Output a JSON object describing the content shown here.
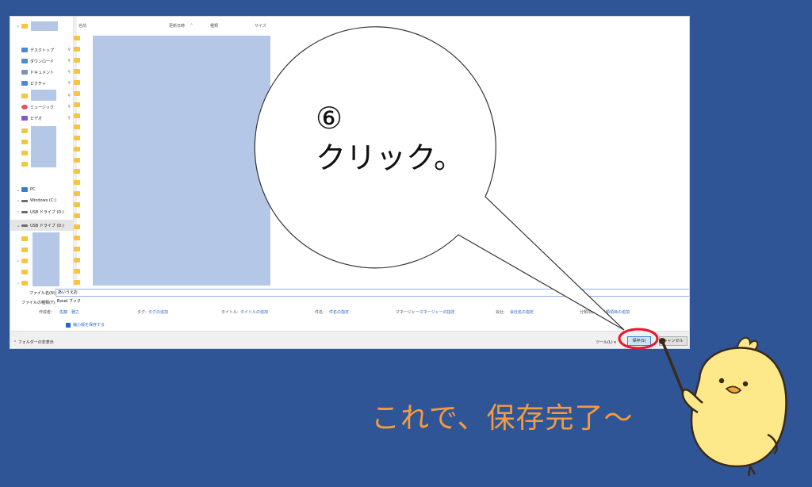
{
  "dialog": {
    "nav_items": [
      {
        "label": "",
        "icon": "folder-icon",
        "pinned": false
      },
      {
        "label": "デスクトップ",
        "icon": "desktop-icon",
        "pinned": true
      },
      {
        "label": "ダウンロード",
        "icon": "download-icon",
        "pinned": true
      },
      {
        "label": "ドキュメント",
        "icon": "document-icon",
        "pinned": true
      },
      {
        "label": "ピクチャ",
        "icon": "picture-icon",
        "pinned": true
      },
      {
        "label": "",
        "icon": "folder-icon",
        "pinned": true
      },
      {
        "label": "ミュージック",
        "icon": "music-icon",
        "pinned": true
      },
      {
        "label": "ビデオ",
        "icon": "video-icon",
        "pinned": true
      },
      {
        "label": "PC",
        "icon": "pc-icon",
        "pinned": false
      },
      {
        "label": "Windows (C:)",
        "icon": "drive-icon",
        "pinned": false
      },
      {
        "label": "USB ドライブ (D:)",
        "icon": "usb-drive-icon",
        "pinned": false
      },
      {
        "label": "USB ドライブ (D:)",
        "icon": "usb-drive-icon",
        "pinned": false,
        "selected": true
      }
    ],
    "columns": [
      "名前",
      "更新日時",
      "種類",
      "サイズ"
    ],
    "file_name_label": "ファイル名(N):",
    "file_name_value": "あいうえお",
    "file_type_label": "ファイルの種類(T):",
    "file_type_value": "Excel ブック",
    "meta": {
      "author_label": "作成者:",
      "author_value": "佐藤　雅之",
      "tags_label": "タグ:",
      "tags_value": "タグの追加",
      "title_label": "タイトル:",
      "title_value": "タイトルの追加",
      "subject_label": "件名:",
      "subject_value": "件名の指定",
      "manager_label": "マネージャー:",
      "manager_value": "マネージャーの指定",
      "company_label": "会社:",
      "company_value": "会社名の指定",
      "category_label": "分類項目:",
      "category_value": "分類項目の追加"
    },
    "thumbnail_label": "縮小版を保存する",
    "hide_folders_label": "フォルダーの非表示",
    "tools_label": "ツール(L)",
    "save_label": "保存(S)",
    "cancel_label": "キャンセル"
  },
  "callout": {
    "step": "⑥",
    "text": "クリック。"
  },
  "message": "これで、保存完了〜",
  "colors": {
    "background": "#2f5597",
    "highlight_circle": "#e8192c",
    "message": "#f39b3e",
    "redaction": "#b4c7e7"
  }
}
